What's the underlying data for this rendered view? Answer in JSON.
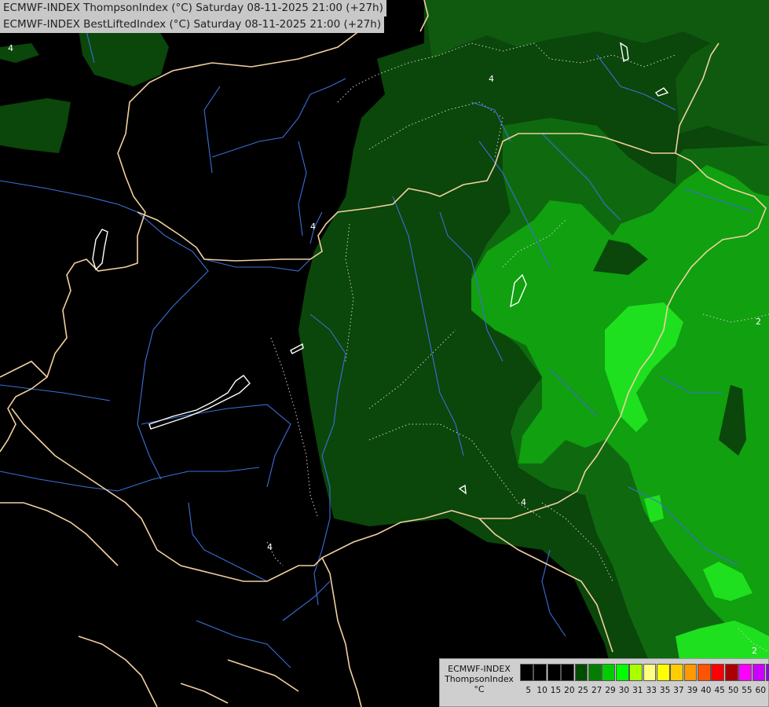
{
  "titles": {
    "line1": "ECMWF-INDEX ThompsonIndex (°C) Saturday 08-11-2025 21:00 (+27h)",
    "line2": "ECMWF-INDEX BestLiftedIndex (°C) Saturday 08-11-2025 21:00 (+27h)"
  },
  "legend": {
    "model": "ECMWF-INDEX",
    "field": "ThompsonIndex",
    "unit": "°C",
    "ticks": [
      "5",
      "10",
      "15",
      "20",
      "25",
      "27",
      "29",
      "30",
      "31",
      "33",
      "35",
      "37",
      "39",
      "40",
      "45",
      "50",
      "55",
      "60"
    ],
    "colors": [
      "#000000",
      "#000000",
      "#000000",
      "#000000",
      "#004d00",
      "#007f00",
      "#00cc00",
      "#00ff00",
      "#aaff00",
      "#ffff80",
      "#ffff00",
      "#ffcc00",
      "#ff9900",
      "#ff5500",
      "#ff0000",
      "#aa0000",
      "#ff00ff",
      "#cc00ff",
      "#8800ff",
      "#0000ff"
    ]
  },
  "contour_labels": [
    "4",
    "4",
    "4",
    "4",
    "4",
    "2",
    "2"
  ],
  "colors": {
    "border": "#f0d0a0",
    "river": "#3b6fd8",
    "lake_outline": "#ffffff",
    "fill_dark": "#0b460b",
    "fill_mid": "#0f6a0f",
    "fill_bright": "#10b010",
    "fill_brightest": "#1fe01f"
  }
}
